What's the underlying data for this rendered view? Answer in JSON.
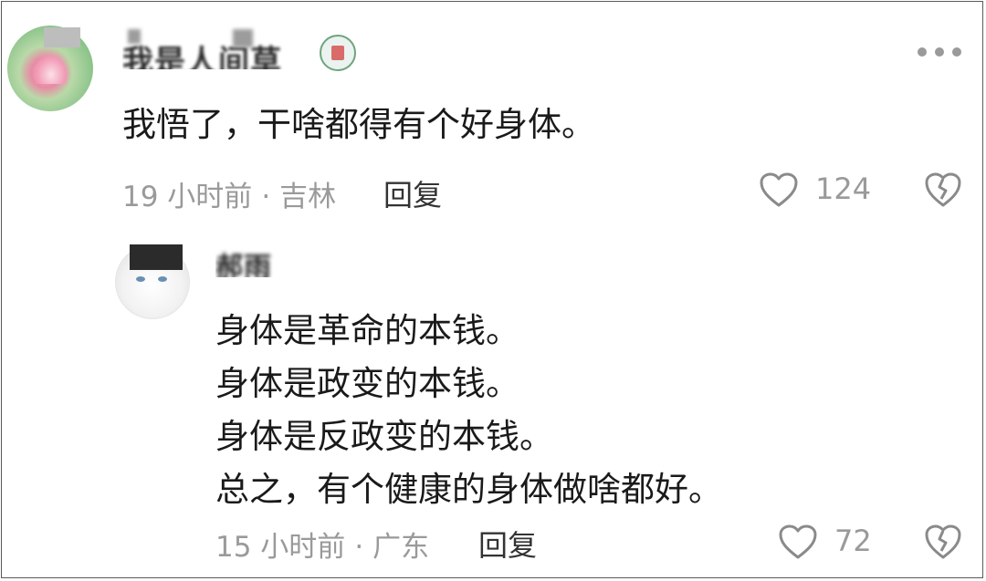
{
  "comment": {
    "username": "我是人间草",
    "text": "我悟了，干啥都得有个好身体。",
    "time": "19 小时前",
    "location": "吉林",
    "reply_label": "回复",
    "likes": "124"
  },
  "reply": {
    "username": "郝雨",
    "lines": [
      "身体是革命的本钱。",
      "身体是政变的本钱。",
      "身体是反政变的本钱。",
      "总之，有个健康的身体做啥都好。"
    ],
    "time": "15 小时前",
    "location": "广东",
    "reply_label": "回复",
    "likes": "72"
  },
  "icons": {
    "like": "heart-icon",
    "dislike": "broken-heart-icon",
    "more": "more-icon",
    "badge": "user-badge-icon"
  }
}
